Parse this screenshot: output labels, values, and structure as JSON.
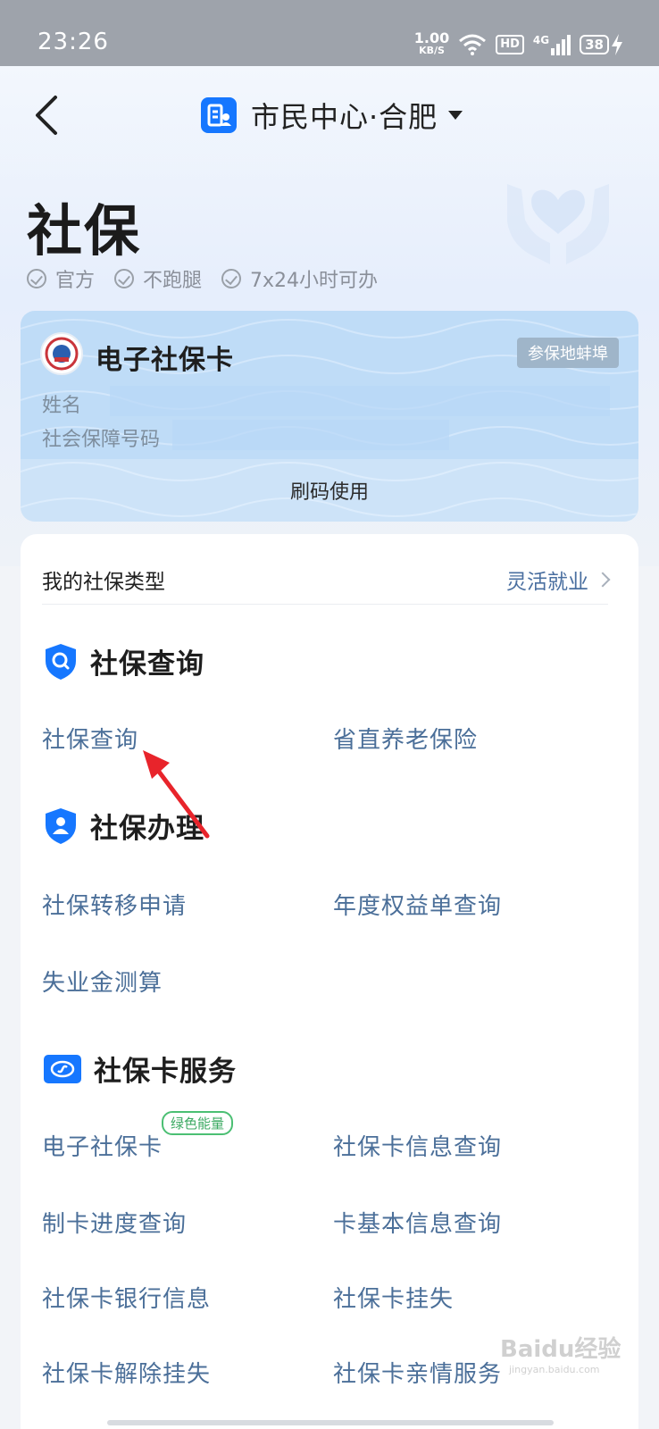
{
  "status_bar": {
    "time": "23:26",
    "net_speed_value": "1.00",
    "net_speed_unit": "KB/S",
    "hd_label": "HD",
    "signal_label": "4G",
    "battery_level": "38"
  },
  "nav": {
    "title": "市民中心·合肥"
  },
  "page": {
    "title": "社保",
    "tags": [
      "官方",
      "不跑腿",
      "7x24小时可办"
    ]
  },
  "ss_card": {
    "title": "电子社保卡",
    "region_badge": "参保地蚌埠",
    "name_label": "姓名",
    "ssn_label": "社会保障号码",
    "action_label": "刷码使用"
  },
  "insurance_type": {
    "label": "我的社保类型",
    "value": "灵活就业"
  },
  "sections": [
    {
      "title": "社保查询",
      "items": [
        "社保查询",
        "省直养老保险"
      ]
    },
    {
      "title": "社保办理",
      "items": [
        "社保转移申请",
        "年度权益单查询",
        "失业金测算"
      ]
    },
    {
      "title": "社保卡服务",
      "items": [
        "电子社保卡",
        "社保卡信息查询",
        "制卡进度查询",
        "卡基本信息查询",
        "社保卡银行信息",
        "社保卡挂失",
        "社保卡解除挂失",
        "社保卡亲情服务"
      ],
      "badge": "绿色能量"
    }
  ],
  "watermark": {
    "text": "Baidu经验",
    "sub": "jingyan.baidu.com"
  },
  "colors": {
    "brand_blue": "#1677ff",
    "link_text": "#4b6f99",
    "arrow_red": "#e8242b",
    "badge_green": "#3daa63"
  }
}
